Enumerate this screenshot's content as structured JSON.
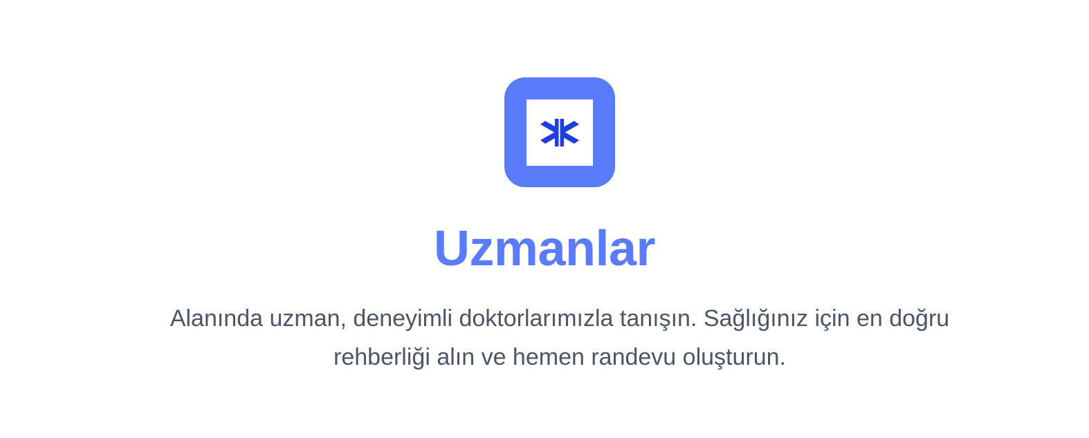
{
  "hero": {
    "logo": {
      "icon": "star-of-life-icon",
      "tile_color": "#5b7cfa",
      "icon_color": "#1f3fdd"
    },
    "title": "Uzmanlar",
    "subtitle": "Alanında uzman, deneyimli doktorlarımızla tanışın. Sağlığınız için en doğru rehberliği alın ve hemen randevu oluşturun."
  },
  "colors": {
    "accent": "#5b7cfa",
    "text_muted": "#4b5563",
    "background": "#ffffff"
  }
}
